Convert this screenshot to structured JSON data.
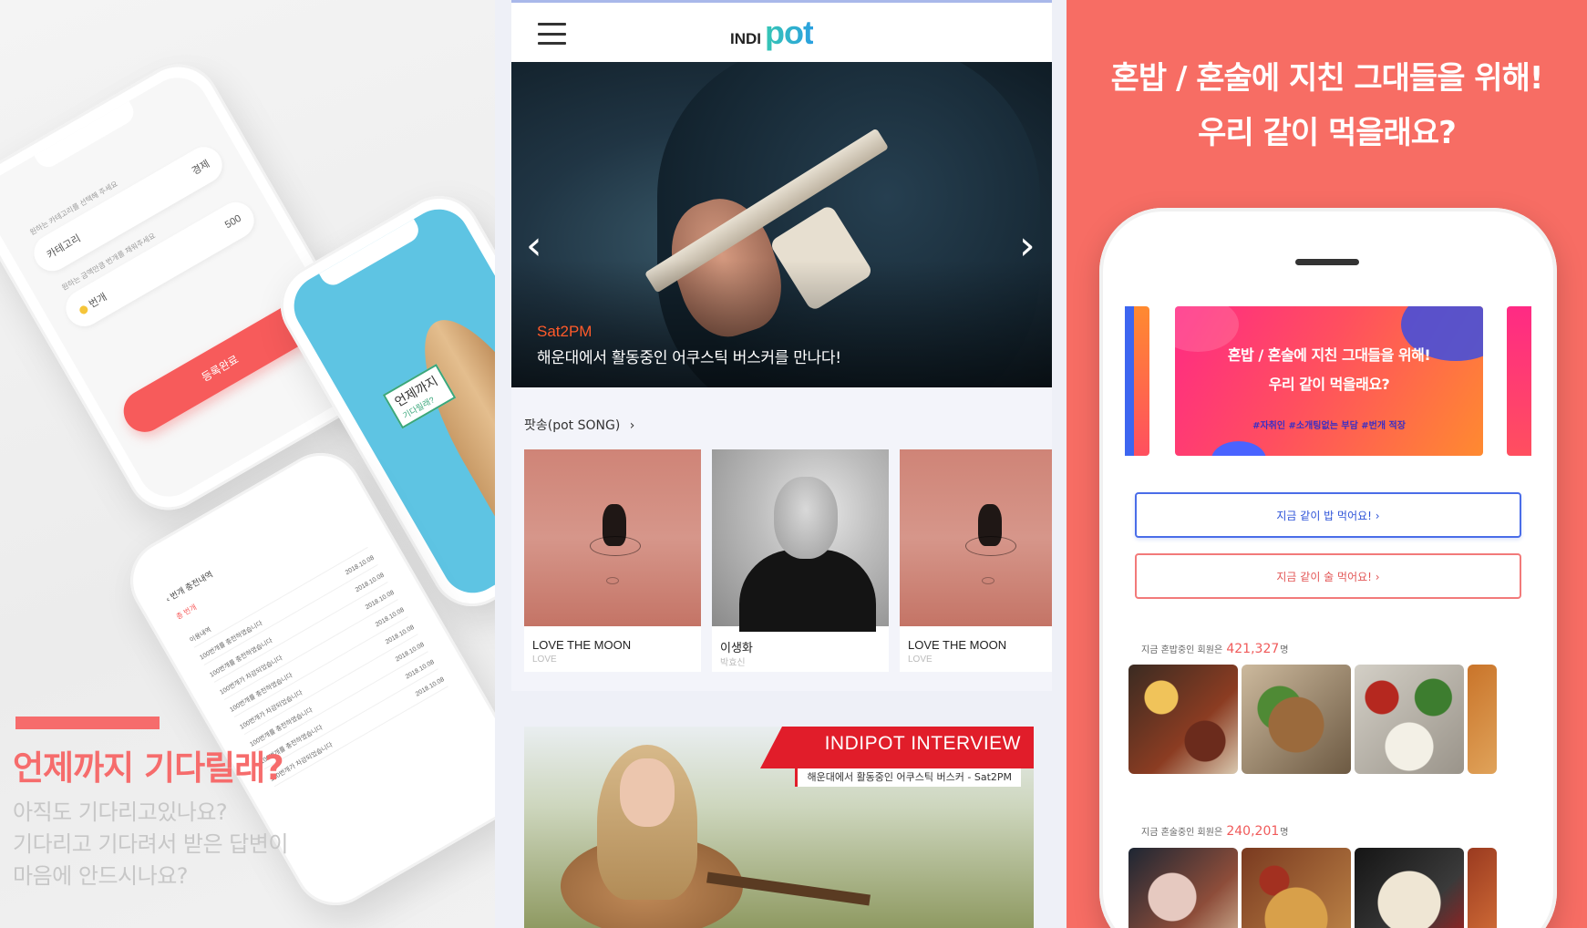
{
  "left": {
    "form": {
      "category_hint": "원하는 카테고리를 선택해 주세요",
      "category_label": "카테고리",
      "category_value": "경제",
      "price_hint": "원하는 금액만큼 번개를 채워주세요",
      "price_label": "번개",
      "price_value": "500",
      "register_button": "등록완료"
    },
    "rocket": {
      "title": "언제까지",
      "subtitle": "기다릴래?"
    },
    "list": {
      "header": "번개 충전내역",
      "sub": "총 번개",
      "rows": [
        {
          "text": "이용내역",
          "date": ""
        },
        {
          "text": "100번개를 충전하였습니다",
          "date": "2018.10.08"
        },
        {
          "text": "100번개를 충전하였습니다",
          "date": "2018.10.08"
        },
        {
          "text": "100번개가 차감되었습니다",
          "date": "2018.10.08"
        },
        {
          "text": "100번개를 충전하였습니다",
          "date": "2018.10.08"
        },
        {
          "text": "100번개가 차감되었습니다",
          "date": "2018.10.08"
        },
        {
          "text": "100번개를 충전하였습니다",
          "date": "2018.10.08"
        },
        {
          "text": "100번개를 충전하였습니다",
          "date": "2018.10.08"
        },
        {
          "text": "100번개가 차감되었습니다",
          "date": "2018.10.08"
        }
      ]
    },
    "headline": "언제까지 기다릴래?",
    "sub_lines": [
      "아직도 기다리고있나요?",
      "기다리고 기다려서 받은 답변이",
      "마음에 안드시나요?"
    ]
  },
  "center": {
    "logo_prefix": "INDI",
    "logo_main": "pot",
    "hero": {
      "prev_arrow": "‹",
      "next_arrow": "›",
      "artist": "Sat2PM",
      "caption": "해운대에서 활동중인 어쿠스틱 버스커를 만나다!"
    },
    "section_title": "팟송(pot SONG)",
    "section_chevron": "›",
    "songs": [
      {
        "title": "LOVE THE MOON",
        "artist": "LOVE",
        "art": "moon"
      },
      {
        "title": "이생화",
        "artist": "박효신",
        "art": "portrait"
      },
      {
        "title": "LOVE THE MOON",
        "artist": "LOVE",
        "art": "moon"
      }
    ],
    "interview": {
      "title": "INDIPOT INTERVIEW",
      "subtitle": "해운대에서 활동중인 어쿠스틱 버스커 - Sat2PM"
    }
  },
  "right": {
    "headline_1": "혼밥 / 혼술에 지친 그대들을 위해!",
    "headline_2": "우리 같이 먹을래요?",
    "banner": {
      "line1": "혼밥 / 혼술에 지친 그대들을 위해!",
      "line2": "우리 같이 먹을래요?",
      "tags": "#자취인 #소개팅없는 부담 #번개 적장"
    },
    "btn_meal": "지금 같이 밥 먹어요!  ›",
    "btn_drink": "지금 같이 술 먹어요!  ›",
    "stat_meal": {
      "prefix": "지금 혼밥중인 회원은",
      "value": "421,327",
      "suffix": "명"
    },
    "stat_drink": {
      "prefix": "지금 혼술중인 회원은",
      "value": "240,201",
      "suffix": "명"
    },
    "colors": {
      "background": "#f76d64",
      "accent_blue": "#4a6de8",
      "accent_red": "#f27a7a"
    }
  }
}
